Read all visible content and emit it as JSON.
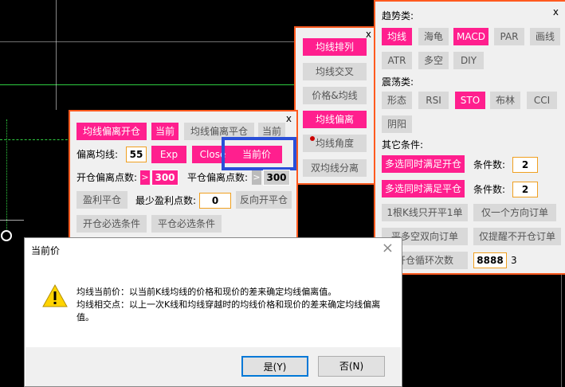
{
  "colors": {
    "accent": "#ff1f8e",
    "panel_border": "#ff5a1f",
    "highlight": "#2a4fd8"
  },
  "close_glyph": "x",
  "panel_mid": {
    "buttons": [
      "均线排列",
      "均线交叉",
      "价格&均线",
      "均线偏离",
      "均线角度",
      "双均线分离"
    ]
  },
  "panel_right": {
    "trend_label": "趋势类:",
    "trend_row1": [
      "均线",
      "海龟",
      "MACD",
      "PAR",
      "画线"
    ],
    "trend_row2": [
      "ATR",
      "多空",
      "DIY"
    ],
    "osc_label": "震荡类:",
    "osc_row1": [
      "形态",
      "RSI",
      "STO",
      "布林",
      "CCI"
    ],
    "osc_row2": [
      "阴阳"
    ],
    "other_label": "其它条件:",
    "multi_open": "多选同时满足开仓",
    "multi_close": "多选同时满足平仓",
    "cond_label": "条件数:",
    "cond_open_value": "2",
    "cond_close_value": "2",
    "one_k": "1根K线只开平1单",
    "one_dir": "仅一个方向订单",
    "both_dir": "平多空双向订单",
    "remind_only": "仅提醒不开仓订单",
    "loop": "开仓循环次数",
    "loop_value": "8888",
    "loop_count": "3"
  },
  "panel_left": {
    "open_btn": "均线偏离开仓",
    "cur1": "当前",
    "close_btn": "均线偏离平仓",
    "cur2": "当前",
    "deviation_label": "偏离均线:",
    "deviation_value": "55",
    "exp": "Exp",
    "close_txt": "Close",
    "current_price": "当前价",
    "open_pts_label": "开仓偏离点数:",
    "open_pts_chev": ">",
    "open_pts_value": "300",
    "close_pts_label": "平仓偏离点数:",
    "close_pts_chev": ">",
    "close_pts_value": "300",
    "profit_close": "盈利平仓",
    "min_profit_label": "最少盈利点数:",
    "min_profit_value": "0",
    "reverse_open": "反向开平仓",
    "open_required": "开仓必选条件",
    "close_required": "平仓必选条件"
  },
  "dialog": {
    "title": "当前价",
    "line1": "均线当前价：以当前K线均线的价格和现价的差来确定均线偏离值。",
    "line2": "均线相交点：以上一次K线和均线穿越时的均线价格和现价的差来确定均线偏离值。",
    "yes": "是(Y)",
    "no": "否(N)",
    "warning_icon": "warning-icon",
    "close_icon": "close-icon"
  }
}
